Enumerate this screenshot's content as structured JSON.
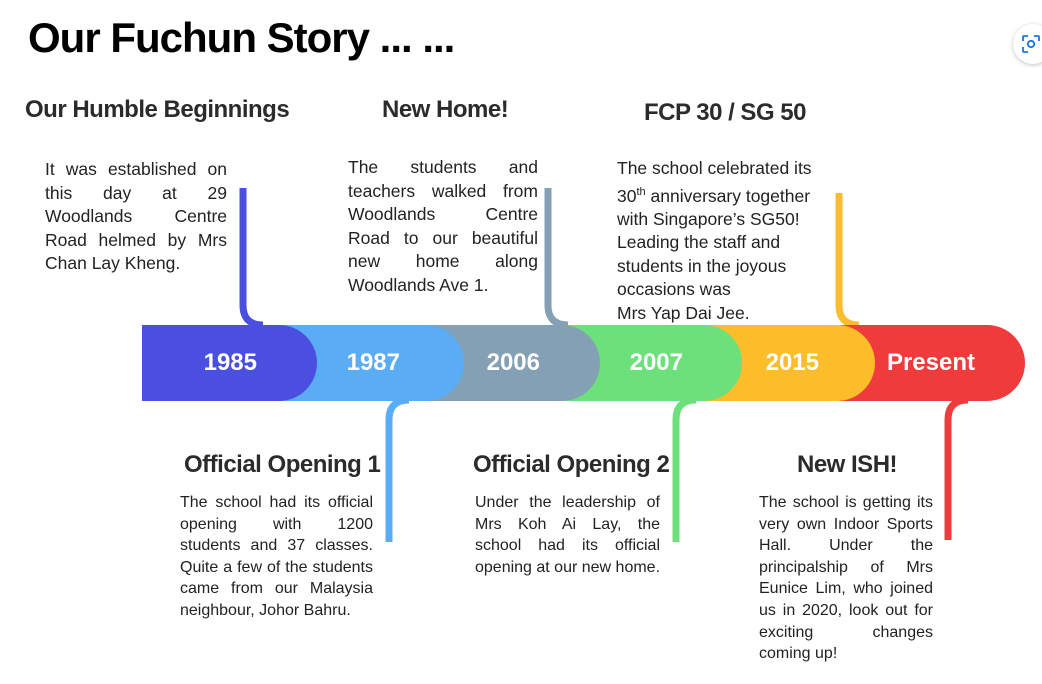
{
  "title": "Our Fuchun Story ... ...",
  "colors": {
    "c1985": "#4a4fe0",
    "c1987": "#5aacf4",
    "c2006": "#84a0b4",
    "c2007": "#6ce07a",
    "c2015": "#fbbd2a",
    "present": "#ef3b3b"
  },
  "segments": [
    "1985",
    "1987",
    "2006",
    "2007",
    "2015",
    "Present"
  ],
  "events": {
    "humble": {
      "heading": "Our Humble Beginnings",
      "text": "It was established on this day at 29 Woodlands Centre Road helmed by Mrs Chan Lay Kheng."
    },
    "new_home": {
      "heading": "New Home!",
      "text": "The students and teachers walked from Woodlands Centre Road to our beautiful new home along Woodlands Ave 1."
    },
    "fcp30": {
      "heading": "FCP 30 / SG 50",
      "line1_pre": "The school celebrated its",
      "line2_num": "30",
      "line2_sup": "th",
      "line2_post": " anniversary together",
      "line3": "with Singapore’s  SG50!",
      "line4": "Leading the staff and",
      "line5": "students in the joyous",
      "line6": "occasions was",
      "line7": "Mrs Yap Dai Jee."
    },
    "opening1": {
      "heading": "Official Opening 1",
      "text": "The school had its official opening with 1200 students and 37 classes. Quite a few of the students came from our Malaysia neighbour, Johor Bahru."
    },
    "opening2": {
      "heading": "Official Opening 2",
      "text": "Under the leadership of Mrs Koh Ai Lay, the school had its official opening at our new home."
    },
    "ish": {
      "heading": "New ISH!",
      "text": "The school is getting its very own Indoor Sports Hall. Under the principalship of Mrs Eunice Lim, who joined us in 2020, look out for exciting changes coming up!"
    }
  },
  "icons": {
    "lens": "lens-scan-icon"
  }
}
